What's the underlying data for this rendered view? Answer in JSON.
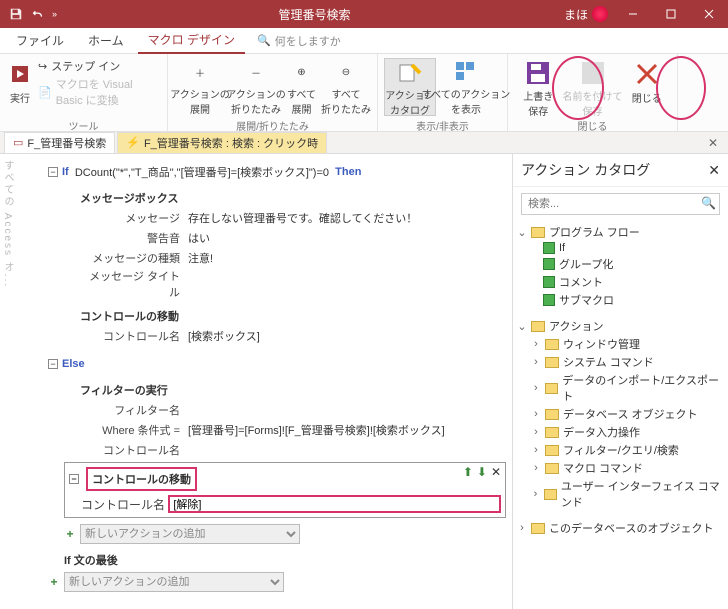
{
  "titlebar": {
    "title": "管理番号検索",
    "user": "まほ"
  },
  "tabs": {
    "file": "ファイル",
    "home": "ホーム",
    "macrodesign": "マクロ デザイン",
    "search_placeholder": "何をしますか"
  },
  "ribbon": {
    "tools": {
      "run": "実行",
      "stepin": "ステップ イン",
      "convert": "マクロを Visual Basic に変換",
      "group": "ツール"
    },
    "expand": {
      "action_expand": "アクションの\n展開",
      "action_collapse": "アクションの\n折りたたみ",
      "all_expand": "すべて\n展開",
      "all_collapse": "すべて\n折りたたみ",
      "group": "展開/折りたたみ"
    },
    "show": {
      "catalog": "アクション\nカタログ",
      "allactions": "すべてのアクション\nを表示",
      "group": "表示/非表示"
    },
    "close": {
      "save": "上書き\n保存",
      "saveas": "名前を付けて\n保存",
      "close": "閉じる",
      "group": "閉じる"
    }
  },
  "doctabs": {
    "tab1": "F_管理番号検索",
    "tab2": "F_管理番号検索 : 検索 : クリック時"
  },
  "macro": {
    "if": "If",
    "if_expr": "DCount(\"*\",\"T_商品\",\"[管理番号]=[検索ボックス]\")=0",
    "then": "Then",
    "msgbox": "メッセージボックス",
    "msg_label": "メッセージ",
    "msg_val": "存在しない管理番号です。確認してください！",
    "beep_label": "警告音",
    "beep_val": "はい",
    "type_label": "メッセージの種類",
    "type_val": "注意!",
    "title_label": "メッセージ タイトル",
    "goto1": "コントロールの移動",
    "ctrl_label": "コントロール名",
    "ctrl_val1": "[検索ボックス]",
    "else": "Else",
    "applyfilter": "フィルターの実行",
    "filtername_label": "フィルター名",
    "where_label": "Where 条件式 =",
    "where_val": "[管理番号]=[Forms]![F_管理番号検索]![検索ボックス]",
    "ctrl_label2": "コントロール名",
    "goto2": "コントロールの移動",
    "ctrl_input": "[解除]",
    "add_action": "新しいアクションの追加",
    "endif_after": "If 文の最後"
  },
  "catalog": {
    "title": "アクション カタログ",
    "search": "検索...",
    "progflow": "プログラム フロー",
    "pf_if": "If",
    "pf_group": "グループ化",
    "pf_comment": "コメント",
    "pf_submacro": "サブマクロ",
    "actions": "アクション",
    "a_window": "ウィンドウ管理",
    "a_system": "システム コマンド",
    "a_import": "データのインポート/エクスポート",
    "a_dbobj": "データベース オブジェクト",
    "a_entry": "データ入力操作",
    "a_filter": "フィルター/クエリ/検索",
    "a_macro": "マクロ コマンド",
    "a_ui": "ユーザー インターフェイス コマンド",
    "thisdb": "このデータベースのオブジェクト"
  },
  "sidebar": "すべての Access オ..."
}
